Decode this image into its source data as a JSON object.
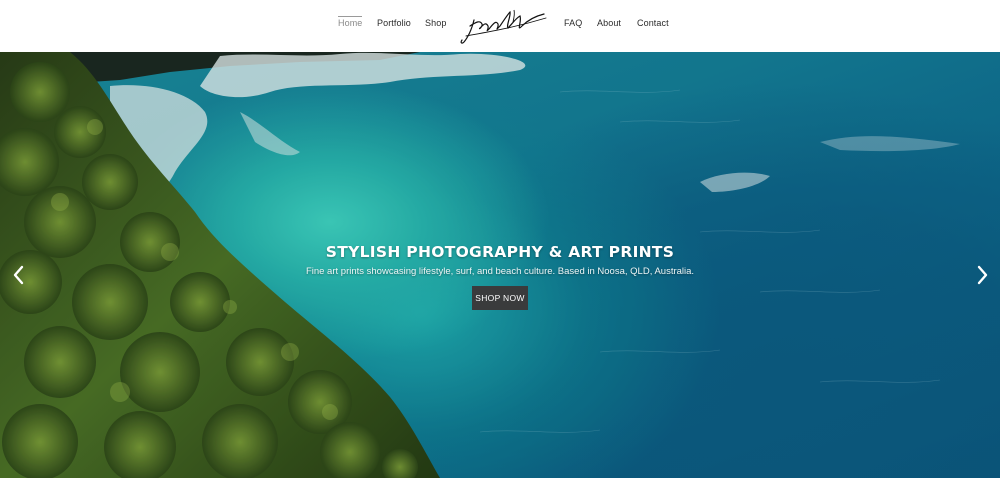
{
  "nav": {
    "items": [
      {
        "label": "Home",
        "active": true
      },
      {
        "label": "Portfolio",
        "active": false
      },
      {
        "label": "Shop",
        "active": false
      },
      {
        "label": "FAQ",
        "active": false
      },
      {
        "label": "About",
        "active": false
      },
      {
        "label": "Contact",
        "active": false
      }
    ],
    "logo_icon": "signature-logo"
  },
  "hero": {
    "title": "STYLISH PHOTOGRAPHY & ART PRINTS",
    "subtitle": "Fine art prints showcasing lifestyle, surf, and beach culture. Based in Noosa, QLD, Australia.",
    "button_label": "SHOP NOW",
    "prev_icon": "chevron-left-icon",
    "next_icon": "chevron-right-icon",
    "image_icon": "aerial-ocean-cliff-photo"
  },
  "colors": {
    "nav_text": "#2b2b2b",
    "nav_active": "#8a8a8a",
    "button_bg": "#3a3b3c",
    "ocean_deep": "#0b5c83",
    "ocean_turquoise": "#3fd6c4",
    "foliage": "#4f7a2a"
  }
}
